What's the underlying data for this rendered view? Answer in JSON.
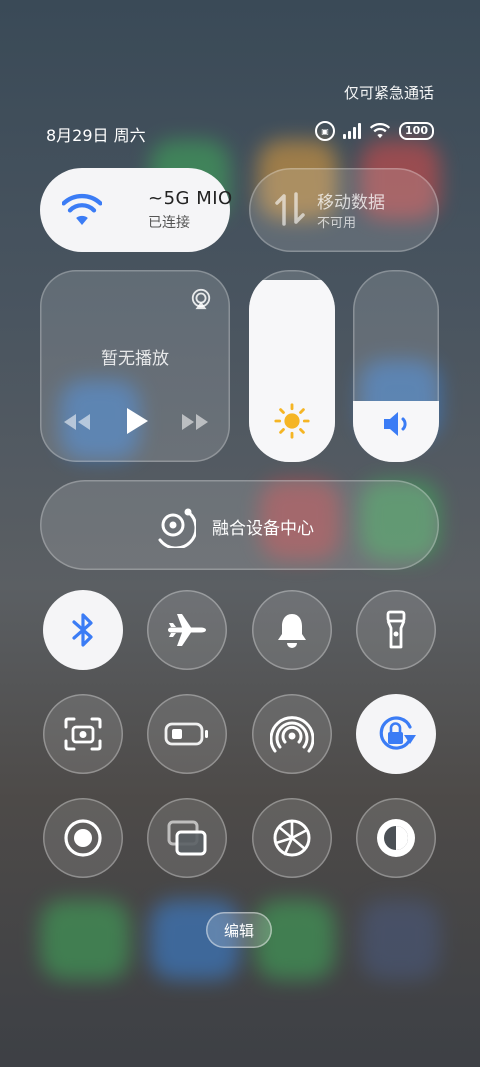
{
  "status": {
    "emergency_text": "仅可紧急通话",
    "date": "8月29日 周六",
    "battery": "100"
  },
  "wifi": {
    "name": "~5G      MIO",
    "status": "已连接",
    "accent": "#3b7cf5"
  },
  "mobile_data": {
    "title": "移动数据",
    "status": "不可用"
  },
  "media": {
    "now_playing": "暂无播放"
  },
  "brightness": {
    "level_percent": 95
  },
  "volume": {
    "level_percent": 32
  },
  "device_hub": {
    "label": "融合设备中心"
  },
  "toggles": [
    {
      "name": "bluetooth",
      "icon": "bluetooth-icon",
      "on": true
    },
    {
      "name": "airplane",
      "icon": "airplane-icon",
      "on": false
    },
    {
      "name": "ring",
      "icon": "bell-icon",
      "on": false
    },
    {
      "name": "flashlight",
      "icon": "flashlight-icon",
      "on": false
    },
    {
      "name": "screenshot",
      "icon": "screenshot-icon",
      "on": false
    },
    {
      "name": "battery-saver",
      "icon": "battery-icon",
      "on": false
    },
    {
      "name": "hotspot",
      "icon": "hotspot-icon",
      "on": false
    },
    {
      "name": "rotation-lock",
      "icon": "rotation-lock-icon",
      "on": true
    },
    {
      "name": "screen-record",
      "icon": "record-icon",
      "on": false
    },
    {
      "name": "multi-window",
      "icon": "multi-window-icon",
      "on": false
    },
    {
      "name": "settings",
      "icon": "aperture-icon",
      "on": false
    },
    {
      "name": "dark-mode",
      "icon": "dark-mode-icon",
      "on": false
    }
  ],
  "edit_label": "编辑"
}
